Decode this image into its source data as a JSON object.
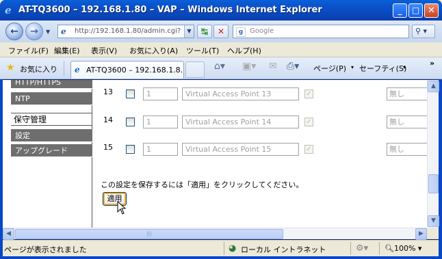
{
  "window": {
    "title": "AT-TQ3600 – 192.168.1.80 – VAP – Windows Internet Explorer"
  },
  "address_bar": {
    "url": "http://192.168.1.80/admin.cgi?",
    "search_placeholder": "Google"
  },
  "menu": {
    "items": [
      "ファイル(F)",
      "編集(E)",
      "表示(V)",
      "お気に入り(A)",
      "ツール(T)",
      "ヘルプ(H)"
    ]
  },
  "favorites_bar": {
    "favorites_label": "お気に入り",
    "tab_label": "AT-TQ3600 – 192.168.1.8...",
    "page_menu": "ページ(P)",
    "safety_menu": "セーフティ(S)",
    "chevron": "»"
  },
  "sidebar": {
    "item_http": "HTTP/HTTPS",
    "item_ntp": "NTP",
    "section_maintenance": "保守管理",
    "item_settings": "設定",
    "item_upgrade": "アップグレード"
  },
  "vap_rows": [
    {
      "num": "13",
      "value": "1",
      "name": "Virtual Access Point 13",
      "security": "無し"
    },
    {
      "num": "14",
      "value": "1",
      "name": "Virtual Access Point 14",
      "security": "無し"
    },
    {
      "num": "15",
      "value": "1",
      "name": "Virtual Access Point 15",
      "security": "無し"
    }
  ],
  "footer": {
    "note": "この設定を保存するには「適用」をクリックしてください。",
    "apply_label": "適用"
  },
  "statusbar": {
    "status_text": "ページが表示されました",
    "zone": "ローカル イントラネット",
    "zoom": "100%"
  },
  "icons": [
    "ie-logo-icon",
    "back-arrow-icon",
    "forward-arrow-icon",
    "refresh-icon",
    "stop-icon",
    "search-icon",
    "star-icon",
    "home-icon",
    "rss-icon",
    "mail-icon",
    "print-icon",
    "globe-icon",
    "zoom-icon"
  ]
}
